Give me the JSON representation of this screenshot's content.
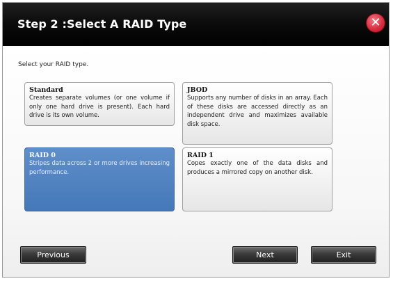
{
  "window": {
    "title": "Step 2 :Select A RAID Type",
    "close_icon": "close-icon",
    "close_color": "#d42a3c"
  },
  "instruction": "Select your RAID type.",
  "options": [
    {
      "name": "Standard",
      "description": "Creates separate volumes (or one volume if only one hard drive is present). Each hard drive is its own volume.",
      "selected": false
    },
    {
      "name": "JBOD",
      "description": "Supports any number of disks in an array. Each of these disks are accessed directly as an independent drive and maximizes available disk space.",
      "selected": false
    },
    {
      "name": "RAID 0",
      "description": "Stripes data across 2 or more drives increasing performance.",
      "selected": true
    },
    {
      "name": "RAID 1",
      "description": "Copes exactly one of the data disks and produces a mirrored copy on another disk.",
      "selected": false
    }
  ],
  "buttons": {
    "previous": "Previous",
    "next": "Next",
    "exit": "Exit"
  },
  "colors": {
    "title_bar": "#000000",
    "selected_option": "#4f82c2"
  }
}
